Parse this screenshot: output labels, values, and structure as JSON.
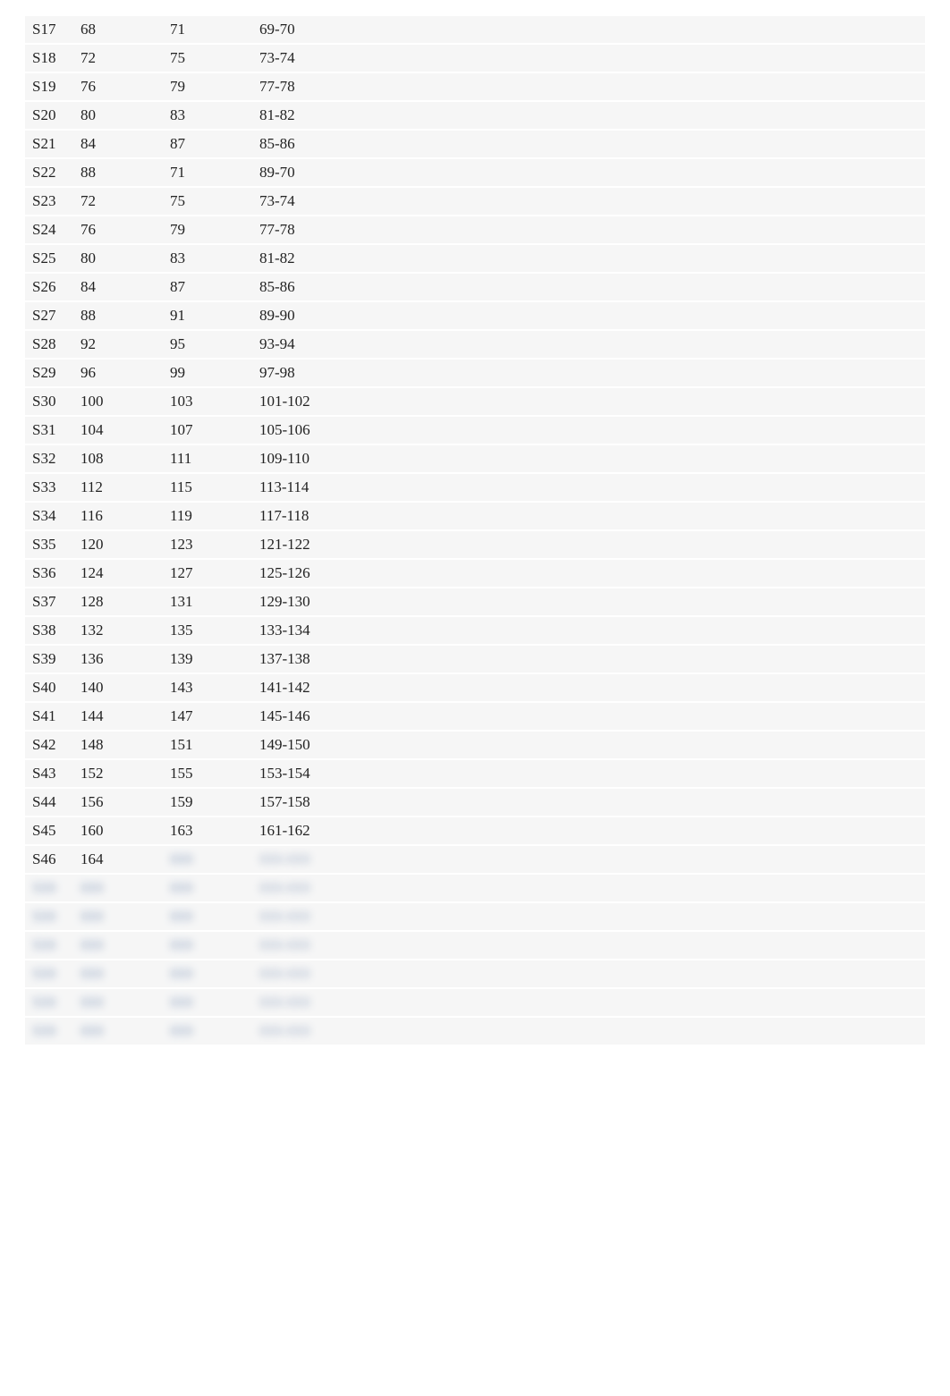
{
  "rows": [
    {
      "label": "S17",
      "col2": "68",
      "col3": "71",
      "col4": "69-70"
    },
    {
      "label": "S18",
      "col2": "72",
      "col3": "75",
      "col4": "73-74"
    },
    {
      "label": "S19",
      "col2": "76",
      "col3": "79",
      "col4": "77-78"
    },
    {
      "label": "S20",
      "col2": "80",
      "col3": "83",
      "col4": "81-82"
    },
    {
      "label": "S21",
      "col2": "84",
      "col3": "87",
      "col4": "85-86"
    },
    {
      "label": "S22",
      "col2": "88",
      "col3": "71",
      "col4": "89-70"
    },
    {
      "label": "S23",
      "col2": "72",
      "col3": "75",
      "col4": "73-74"
    },
    {
      "label": "S24",
      "col2": "76",
      "col3": "79",
      "col4": "77-78"
    },
    {
      "label": "S25",
      "col2": "80",
      "col3": "83",
      "col4": "81-82"
    },
    {
      "label": "S26",
      "col2": "84",
      "col3": "87",
      "col4": "85-86"
    },
    {
      "label": "S27",
      "col2": "88",
      "col3": "91",
      "col4": "89-90"
    },
    {
      "label": "S28",
      "col2": "92",
      "col3": "95",
      "col4": "93-94"
    },
    {
      "label": "S29",
      "col2": "96",
      "col3": "99",
      "col4": "97-98"
    },
    {
      "label": "S30",
      "col2": "100",
      "col3": "103",
      "col4": "101-102"
    },
    {
      "label": "S31",
      "col2": "104",
      "col3": "107",
      "col4": "105-106"
    },
    {
      "label": "S32",
      "col2": "108",
      "col3": "111",
      "col4": "109-110"
    },
    {
      "label": "S33",
      "col2": "112",
      "col3": "115",
      "col4": "113-114"
    },
    {
      "label": "S34",
      "col2": "116",
      "col3": "119",
      "col4": "117-118"
    },
    {
      "label": "S35",
      "col2": "120",
      "col3": "123",
      "col4": "121-122"
    },
    {
      "label": "S36",
      "col2": "124",
      "col3": "127",
      "col4": "125-126"
    },
    {
      "label": "S37",
      "col2": "128",
      "col3": "131",
      "col4": "129-130"
    },
    {
      "label": "S38",
      "col2": "132",
      "col3": "135",
      "col4": "133-134"
    },
    {
      "label": "S39",
      "col2": "136",
      "col3": "139",
      "col4": "137-138"
    },
    {
      "label": "S40",
      "col2": "140",
      "col3": "143",
      "col4": "141-142"
    },
    {
      "label": "S41",
      "col2": "144",
      "col3": "147",
      "col4": "145-146"
    },
    {
      "label": "S42",
      "col2": "148",
      "col3": "151",
      "col4": "149-150"
    },
    {
      "label": "S43",
      "col2": "152",
      "col3": "155",
      "col4": "153-154"
    },
    {
      "label": "S44",
      "col2": "156",
      "col3": "159",
      "col4": "157-158"
    },
    {
      "label": "S45",
      "col2": "160",
      "col3": "163",
      "col4": "161-162"
    },
    {
      "label": "S46",
      "col2": "164",
      "col3": "",
      "col4": "",
      "col3_blur": true,
      "col4_blur": true
    },
    {
      "label": "",
      "col2": "",
      "col3": "",
      "col4": "",
      "all_blur": true
    },
    {
      "label": "",
      "col2": "",
      "col3": "",
      "col4": "",
      "all_blur": true
    },
    {
      "label": "",
      "col2": "",
      "col3": "",
      "col4": "",
      "all_blur": true
    },
    {
      "label": "",
      "col2": "",
      "col3": "",
      "col4": "",
      "all_blur": true
    },
    {
      "label": "",
      "col2": "",
      "col3": "",
      "col4": "",
      "all_blur": true
    },
    {
      "label": "",
      "col2": "",
      "col3": "",
      "col4": "",
      "all_blur": true
    }
  ]
}
